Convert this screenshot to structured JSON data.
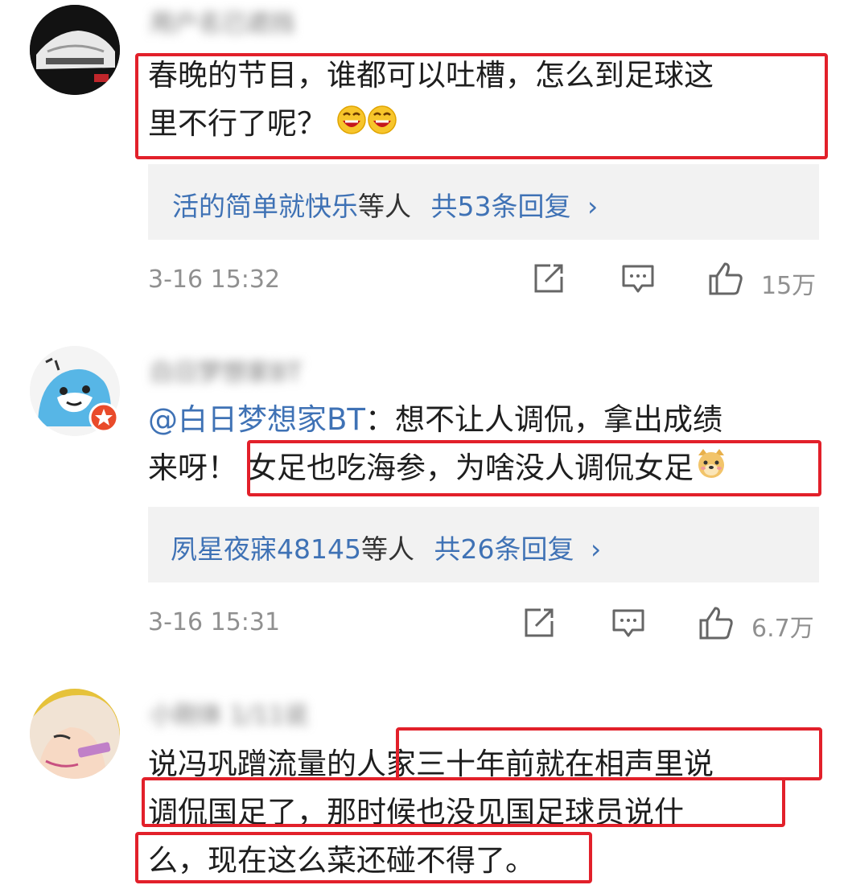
{
  "comments": [
    {
      "username": "用户名已遮挡",
      "text_line1": "春晚的节目，谁都可以吐槽，怎么到足球这",
      "text_line2": "里不行了呢？",
      "replies": {
        "users": "活的简单就快乐",
        "middle": "等人",
        "count": "共53条回复",
        "chevron": "›"
      },
      "time": "3-16 15:32",
      "likes": "15万"
    },
    {
      "username": "白日梦想家BT",
      "mention": "@白日梦想家BT",
      "text_line1_rest": "：想不让人调侃，拿出成绩",
      "text_line2_a": "来呀！",
      "text_line2_b": "女足也吃海参，为啥没人调侃女足",
      "replies": {
        "users": "夙星夜寐48145",
        "middle": "等人",
        "count": "共26条回复",
        "chevron": "›"
      },
      "time": "3-16 15:31",
      "likes": "6.7万"
    },
    {
      "username": "小刚体 1/11说",
      "text_line1_a": "说冯巩蹭流量的",
      "text_line1_b": "人家三十年前就在相声里说",
      "text_line2": "调侃国足了，那时候也没见国足球员说什",
      "text_line3": "么，现在这么菜还碰不得了。"
    }
  ],
  "icons": [
    "share-icon",
    "comment-icon",
    "like-icon",
    "laugh-emoji",
    "doge-emoji",
    "verified-badge"
  ],
  "colors": {
    "highlight_border": "#e2202a",
    "link": "#3f72b5",
    "reply_bg": "#f2f2f2",
    "meta": "#909090"
  }
}
